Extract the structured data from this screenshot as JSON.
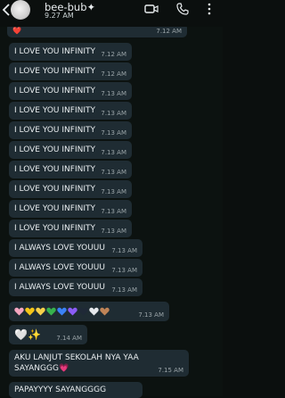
{
  "header": {
    "contact_name": "bee-bub✦",
    "status_time": "9.27 AM"
  },
  "top_message": {
    "time": "7.12 AM"
  },
  "messages": [
    {
      "text": "I LOVE YOU INFINITY",
      "time": "7.12 AM"
    },
    {
      "text": "I LOVE YOU INFINITY",
      "time": "7.12 AM"
    },
    {
      "text": "I LOVE YOU INFINITY",
      "time": "7.13 AM"
    },
    {
      "text": "I LOVE YOU INFINITY",
      "time": "7.13 AM"
    },
    {
      "text": "I LOVE YOU INFINITY",
      "time": "7.13 AM"
    },
    {
      "text": "I LOVE YOU INFINITY",
      "time": "7.13 AM"
    },
    {
      "text": "I LOVE YOU INFINITY",
      "time": "7.13 AM"
    },
    {
      "text": "I LOVE YOU INFINITY",
      "time": "7.13 AM"
    },
    {
      "text": "I LOVE YOU INFINITY",
      "time": "7.13 AM"
    },
    {
      "text": "I LOVE YOU INFINITY",
      "time": "7.13 AM"
    },
    {
      "text": "I ALWAYS LOVE YOUUU",
      "time": "7.13 AM"
    },
    {
      "text": "I ALWAYS LOVE YOUUU",
      "time": "7.13 AM"
    },
    {
      "text": "I ALWAYS LOVE YOUUU",
      "time": "7.13 AM"
    }
  ],
  "hearts_message": {
    "time": "7.13 AM",
    "heart_colors": [
      "#f4a6c0",
      "#f5c518",
      "#f7d14b",
      "#37b24d",
      "#3b82f6",
      "#8b5cf6",
      "#1f2937",
      "#e5e7eb",
      "#c08457"
    ]
  },
  "white_heart_message": {
    "emoji": "🤍✨",
    "time": "7.14 AM"
  },
  "school_message": {
    "text": "AKU LANJUT SEKOLAH NYA YAA SAYANGGG💗",
    "time": "7.15 AM"
  },
  "last_message": {
    "text": "PAPAYYYY SAYANGGGG"
  },
  "colors": {
    "bubble": "#1f2c33",
    "background": "#0c1210",
    "timestamp": "#9aa4a8"
  }
}
